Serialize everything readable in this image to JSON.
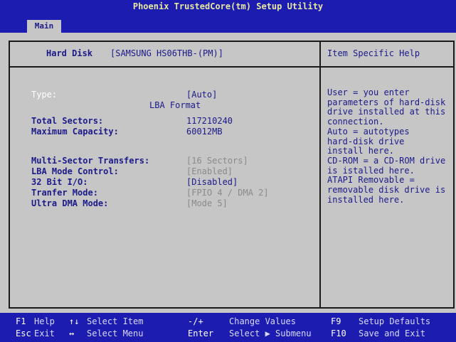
{
  "title": "Phoenix TrustedCore(tm) Setup Utility",
  "tab": "Main",
  "header": {
    "label": "Hard Disk",
    "model": "[SAMSUNG HS06THB-(PM)]",
    "help_title": "Item Specific Help"
  },
  "fields": {
    "type_label": "Type:",
    "type_value": "[Auto]",
    "lba_format": "LBA Format",
    "total_sectors_label": "Total Sectors:",
    "total_sectors_value": "117210240",
    "max_capacity_label": "Maximum Capacity:",
    "max_capacity_value": "60012MB",
    "multi_sector_label": "Multi-Sector Transfers:",
    "multi_sector_value": "[16 Sectors]",
    "lba_mode_label": "LBA Mode Control:",
    "lba_mode_value": "[Enabled]",
    "bit32_label": "32 Bit I/O:",
    "bit32_value": "[Disabled]",
    "transfer_label": "Tranfer Mode:",
    "transfer_value": "[FPIO 4 / DMA 2]",
    "udma_label": "Ultra DMA Mode:",
    "udma_value": "[Mode 5]"
  },
  "help_lines": [
    "User = you enter",
    "parameters of hard-disk",
    "drive installed at this",
    "connection.",
    "Auto = autotypes",
    "hard-disk drive",
    "install here.",
    "CD-ROM = a CD-ROM drive",
    "is istalled here.",
    "ATAPI Removable =",
    "removable disk drive is",
    "installed here."
  ],
  "footer": {
    "row1": [
      {
        "key": "F1",
        "action": "Help"
      },
      {
        "key": "↑↓",
        "action": "Select Item"
      },
      {
        "key": "-/+",
        "action": "Change Values"
      },
      {
        "key": "F9",
        "action": "Setup Defaults"
      }
    ],
    "row2": [
      {
        "key": "Esc",
        "action": "Exit"
      },
      {
        "key": "↔",
        "action": "Select Menu"
      },
      {
        "key": "Enter",
        "action": "Select ▶ Submenu"
      },
      {
        "key": "F10",
        "action": "Save and Exit"
      }
    ]
  }
}
